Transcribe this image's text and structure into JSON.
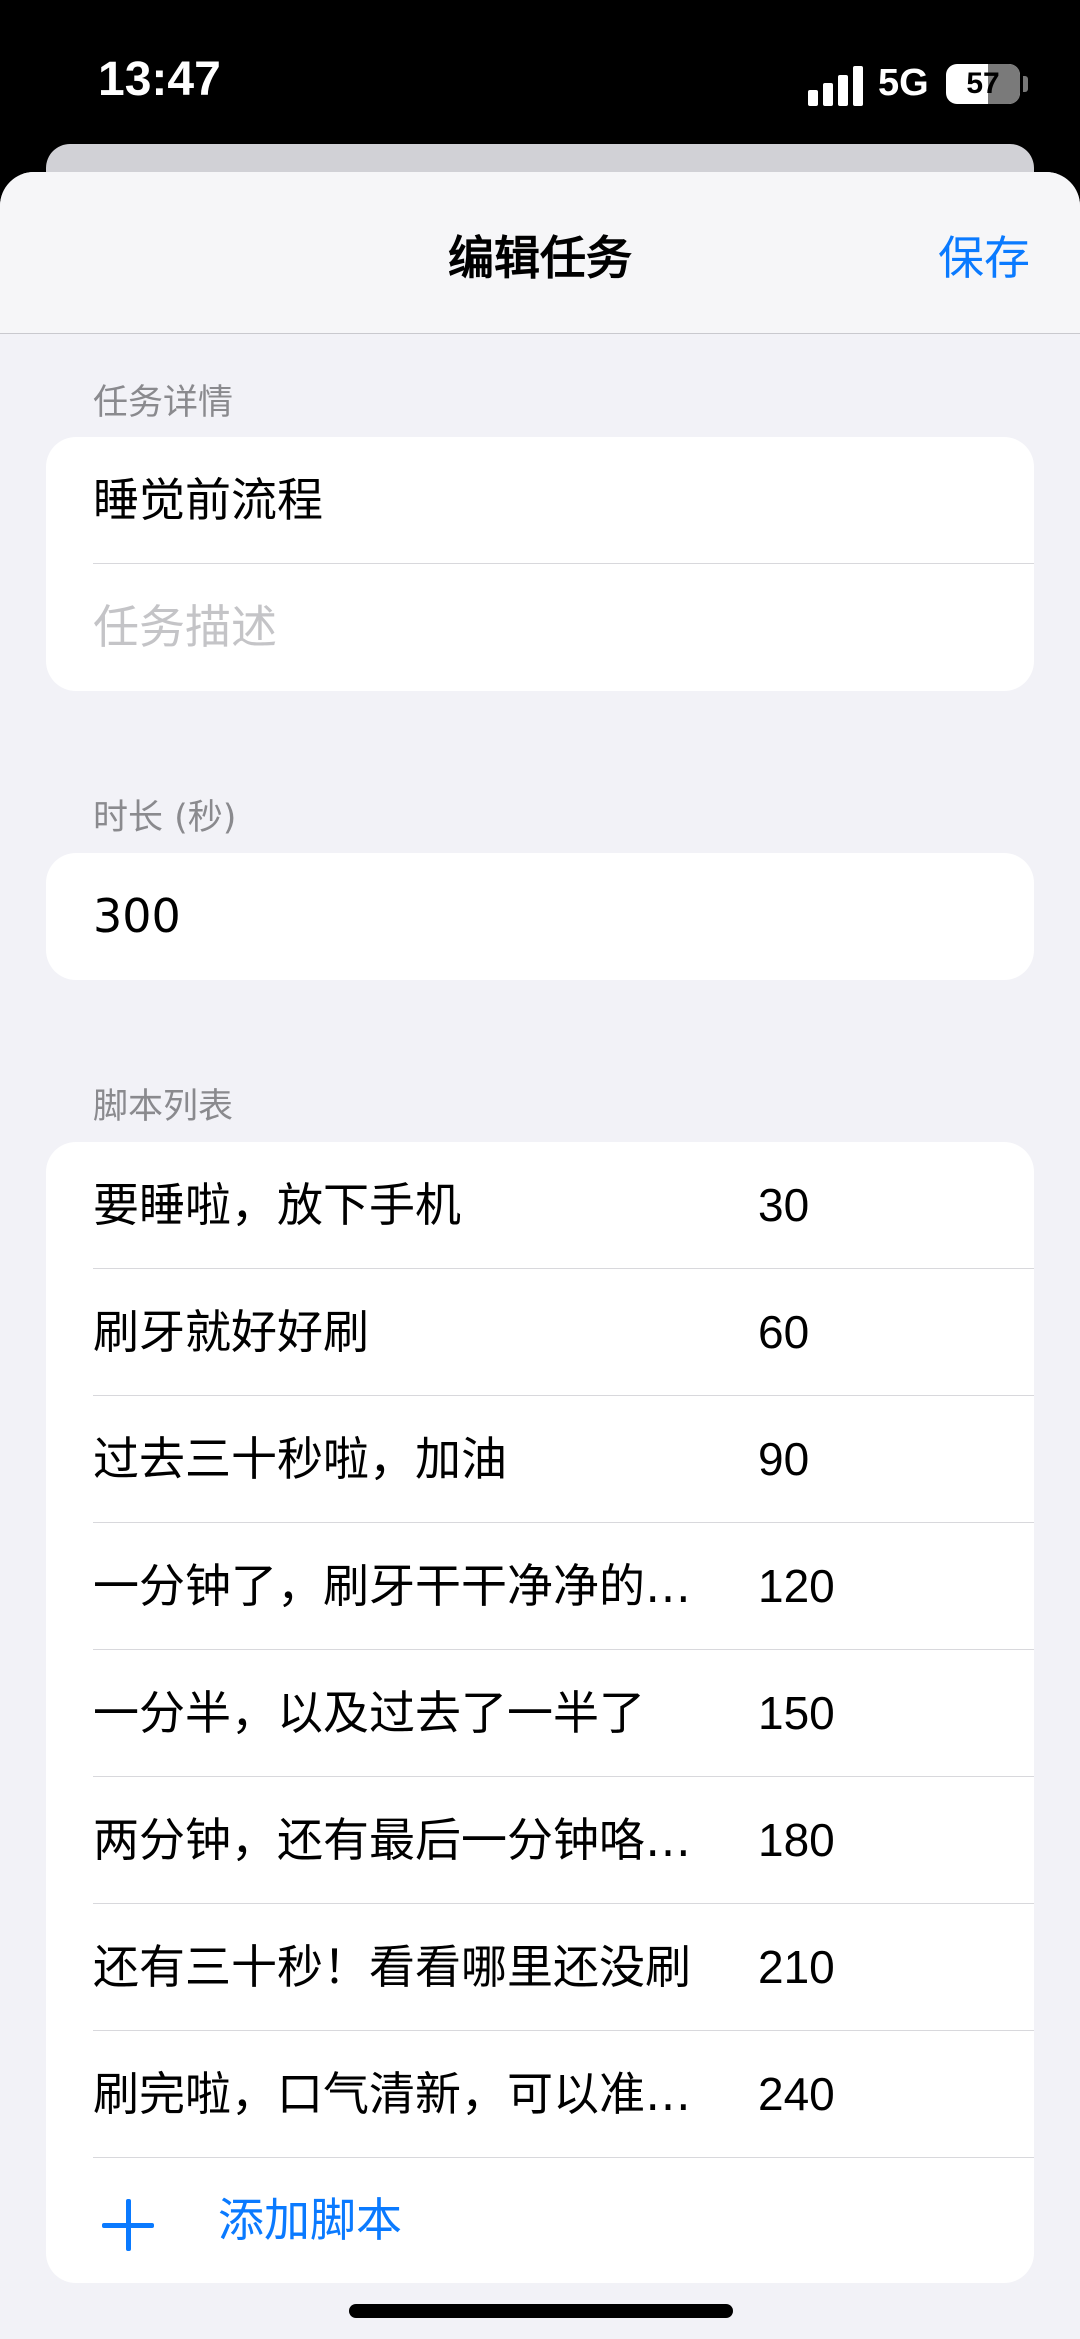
{
  "status_bar": {
    "time": "13:47",
    "network": "5G",
    "battery_level": "57"
  },
  "nav": {
    "title": "编辑任务",
    "save_label": "保存"
  },
  "task_details": {
    "header": "任务详情",
    "name_value": "睡觉前流程",
    "description_placeholder": "任务描述"
  },
  "duration": {
    "header": "时长 (秒)",
    "value": "300"
  },
  "scripts": {
    "header": "脚本列表",
    "items": [
      {
        "text": "要睡啦，放下手机",
        "time": "30"
      },
      {
        "text": "刷牙就好好刷",
        "time": "60"
      },
      {
        "text": "过去三十秒啦，加油",
        "time": "90"
      },
      {
        "text": "一分钟了，刷牙干干净净的…",
        "time": "120"
      },
      {
        "text": "一分半，以及过去了一半了",
        "time": "150"
      },
      {
        "text": "两分钟，还有最后一分钟咯…",
        "time": "180"
      },
      {
        "text": "还有三十秒！看看哪里还没刷",
        "time": "210"
      },
      {
        "text": "刷完啦，口气清新，可以准…",
        "time": "240"
      }
    ],
    "add_label": "添加脚本"
  },
  "colors": {
    "accent": "#0a7aff",
    "background": "#f2f2f7",
    "secondary_text": "#8a8a8e"
  }
}
